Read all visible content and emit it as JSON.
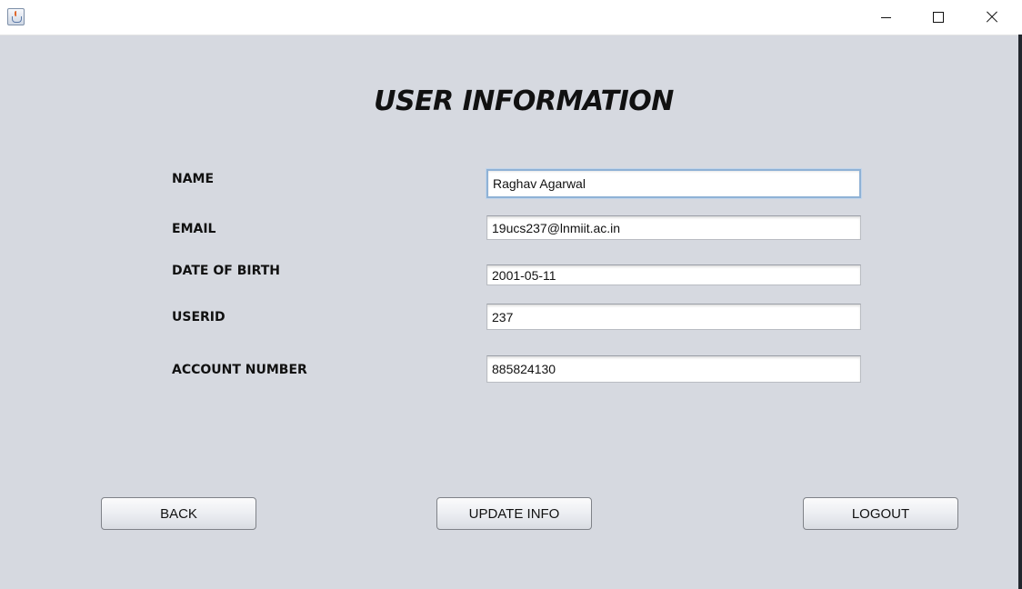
{
  "window": {
    "app_icon": "java-app-icon",
    "controls": [
      "minimize-icon",
      "maximize-icon",
      "close-icon"
    ]
  },
  "title": "USER INFORMATION",
  "fields": {
    "name": {
      "label": "NAME",
      "value": "Raghav Agarwal"
    },
    "email": {
      "label": "EMAIL",
      "value": "19ucs237@lnmiit.ac.in"
    },
    "dob": {
      "label": "DATE OF BIRTH",
      "value": "2001-05-11"
    },
    "userid": {
      "label": "USERID",
      "value": "237"
    },
    "account": {
      "label": "ACCOUNT NUMBER",
      "value": "885824130"
    }
  },
  "buttons": {
    "back": "BACK",
    "update": "UPDATE INFO",
    "logout": "LOGOUT"
  },
  "colors": {
    "background": "#d6d9e0",
    "focus_border": "#8fb2d6"
  }
}
